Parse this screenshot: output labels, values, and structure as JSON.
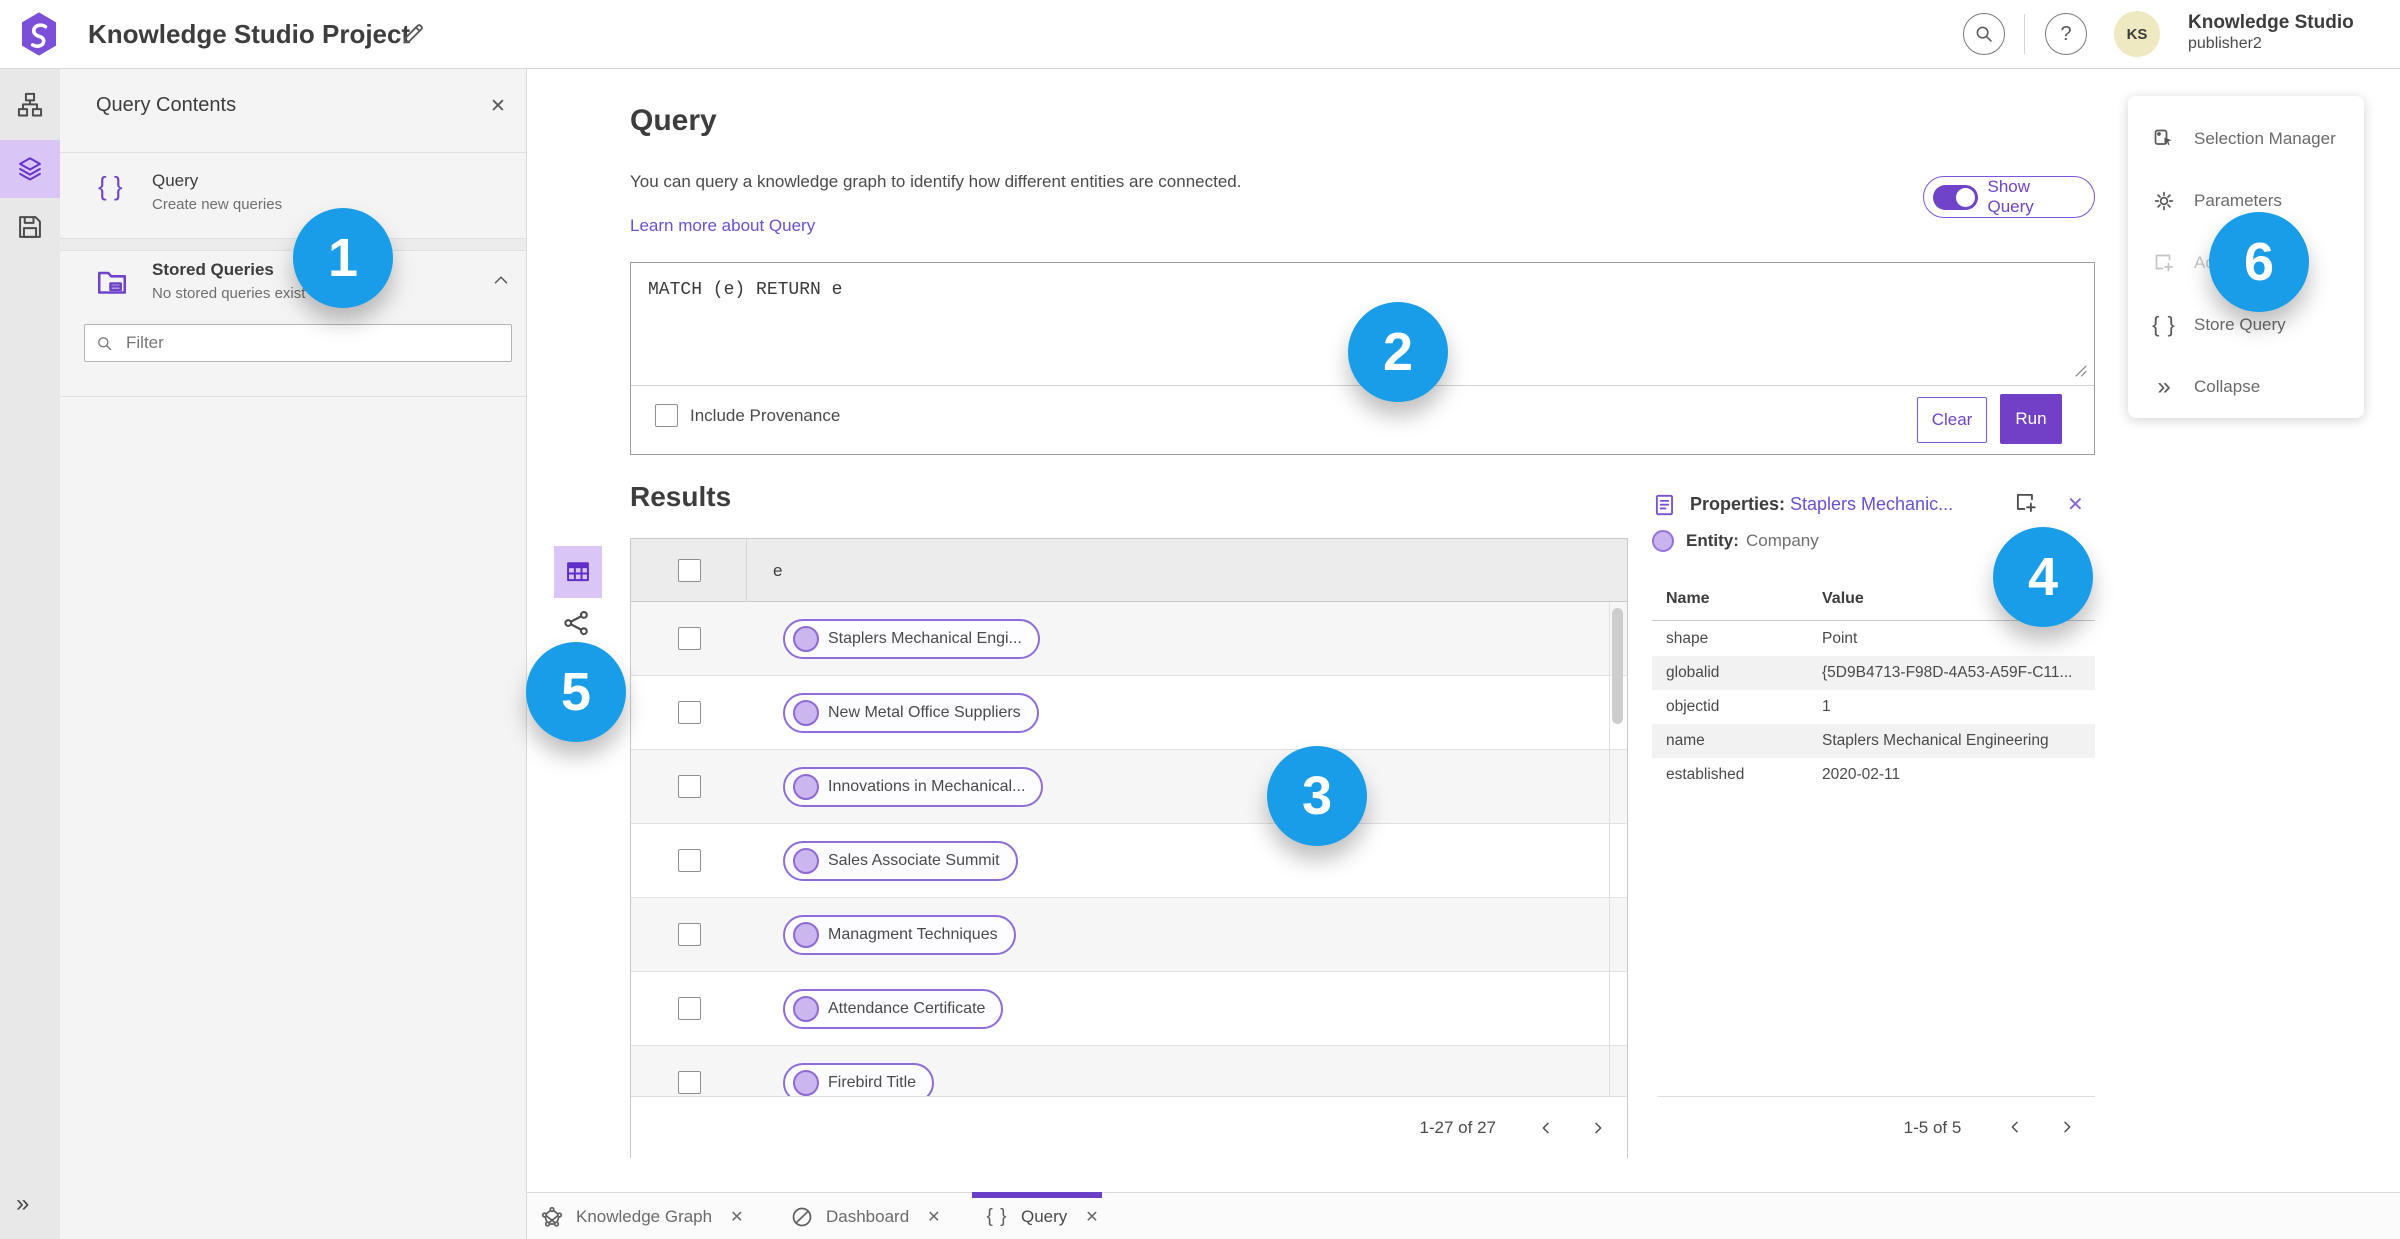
{
  "colors": {
    "accent_purple": "#6f44c9",
    "link_purple": "#6a4fd4",
    "lavender_selected": "#d9c6f6",
    "badge_blue": "#1a9de8",
    "header_text": "#3d3d3d",
    "muted_text": "#6f6f6f",
    "chip_border": "#8f6cd9",
    "avatar_bg": "#eee9c0"
  },
  "icons": {
    "braces": "{ }",
    "close": "✕",
    "collapse": "»",
    "help": "?"
  },
  "header": {
    "app_title": "Knowledge Studio Project",
    "user_name": "Knowledge Studio",
    "user_role": "publisher2",
    "avatar_initials": "KS"
  },
  "query_contents": {
    "title": "Query Contents",
    "items": [
      {
        "label": "Query",
        "description": "Create new queries"
      },
      {
        "label": "Stored Queries",
        "description": "No stored queries exist"
      }
    ],
    "filter_placeholder": "Filter"
  },
  "query_panel": {
    "title": "Query",
    "description": "You can query a knowledge graph to identify how different entities are connected.",
    "learn_more": "Learn more about Query",
    "show_query": "Show Query",
    "query_text": "MATCH (e) RETURN e",
    "include_provenance": "Include Provenance",
    "clear": "Clear",
    "run": "Run"
  },
  "results": {
    "title": "Results",
    "column": "e",
    "rows": [
      "Staplers Mechanical Engi...",
      "New Metal Office Suppliers",
      "Innovations in Mechanical...",
      "Sales Associate Summit",
      "Managment Techniques",
      "Attendance Certificate",
      "Firebird Title"
    ],
    "pagination": "1-27 of 27"
  },
  "properties": {
    "label": "Properties:",
    "link": "Staplers Mechanic...",
    "entity_label": "Entity:",
    "entity_type": "Company",
    "col_name": "Name",
    "col_value": "Value",
    "rows": [
      {
        "name": "shape",
        "value": "Point"
      },
      {
        "name": "globalid",
        "value": "{5D9B4713-F98D-4A53-A59F-C11..."
      },
      {
        "name": "objectid",
        "value": "1"
      },
      {
        "name": "name",
        "value": "Staplers Mechanical Engineering"
      },
      {
        "name": "established",
        "value": "2020-02-11"
      }
    ],
    "pagination": "1-5 of 5"
  },
  "tools": {
    "items": [
      {
        "label": "Selection Manager"
      },
      {
        "label": "Parameters"
      },
      {
        "label": "Ad"
      },
      {
        "label": "Store Query"
      },
      {
        "label": "Collapse"
      }
    ]
  },
  "tabs": [
    {
      "label": "Knowledge Graph"
    },
    {
      "label": "Dashboard"
    },
    {
      "label": "Query"
    }
  ],
  "annotations": {
    "badges": [
      "1",
      "2",
      "3",
      "4",
      "5",
      "6"
    ]
  }
}
